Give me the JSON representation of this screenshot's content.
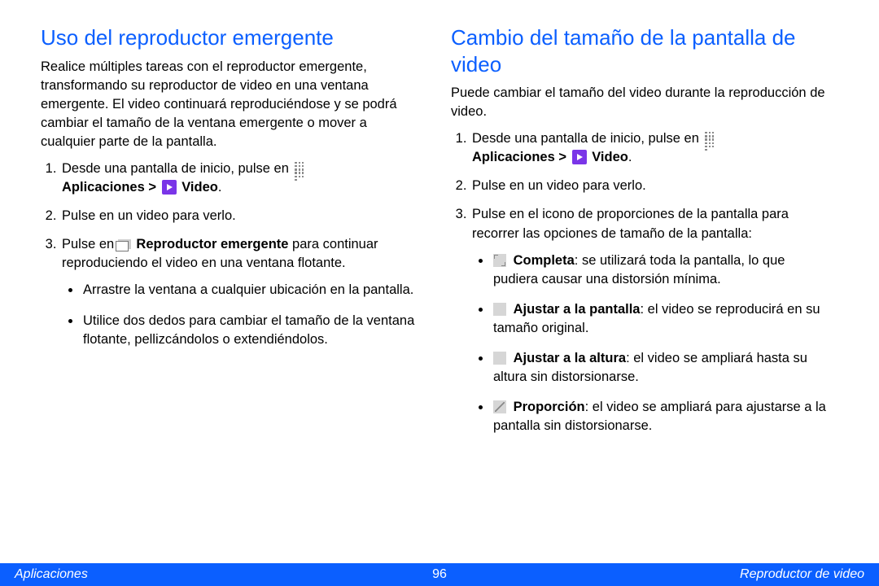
{
  "left": {
    "heading": "Uso del reproductor emergente",
    "intro": "Realice múltiples tareas con el reproductor emergente, transformando su reproductor de video en una ventana emergente. El video continuará reproduciéndose y se podrá cambiar el tamaño de la ventana emergente o mover a cualquier parte de la pantalla.",
    "step1_a": "Desde una pantalla de inicio, pulse en",
    "step1_b": "Aplicaciones >",
    "step1_c": "Video",
    "step2": "Pulse en un video para verlo.",
    "step3_a": "Pulse en",
    "step3_b": "Reproductor emergente",
    "step3_c": "para continuar reproduciendo el video en una ventana flotante.",
    "bullet1": "Arrastre la ventana a cualquier ubicación en la pantalla.",
    "bullet2": "Utilice dos dedos para cambiar el tamaño de la ventana flotante, pellizcándolos o extendiéndolos."
  },
  "right": {
    "heading": "Cambio del tamaño de la pantalla de video",
    "intro": "Puede cambiar el tamaño del video durante la reproducción de video.",
    "step1_a": "Desde una pantalla de inicio, pulse en",
    "step1_b": "Aplicaciones >",
    "step1_c": "Video",
    "step2": "Pulse en un video para verlo.",
    "step3": "Pulse en el icono de proporciones de la pantalla para recorrer las opciones de tamaño de la pantalla:",
    "opt1_b": "Completa",
    "opt1_t": ": se utilizará toda la pantalla, lo que pudiera causar una distorsión mínima.",
    "opt2_b": "Ajustar a la pantalla",
    "opt2_t": ": el video se reproducirá en su tamaño original.",
    "opt3_b": "Ajustar a la altura",
    "opt3_t": ": el video se ampliará hasta su altura sin distorsionarse.",
    "opt4_b": "Proporción",
    "opt4_t": ": el video se ampliará para ajustarse a la pantalla sin distorsionarse."
  },
  "footer": {
    "left": "Aplicaciones",
    "page": "96",
    "right": "Reproductor de video"
  }
}
